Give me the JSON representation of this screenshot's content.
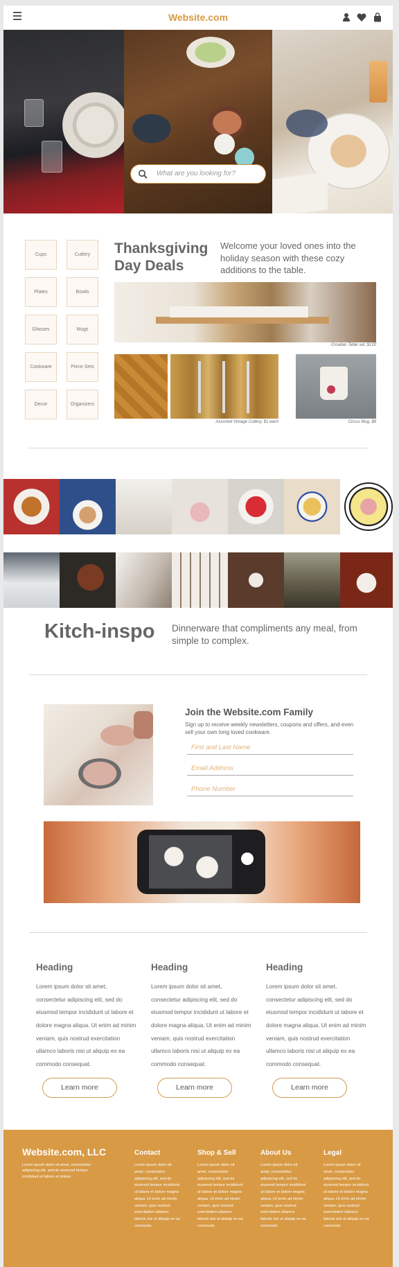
{
  "header": {
    "logo": "Website.com",
    "icons": [
      "menu-icon",
      "user-icon",
      "heart-icon",
      "shopping-bag-icon"
    ]
  },
  "search": {
    "placeholder": "What are you looking for?"
  },
  "categories": [
    "Cups",
    "Cutlery",
    "Plates",
    "Bowls",
    "Glasses",
    "Mugs",
    "Cookware",
    "Piece Sets",
    "Decor",
    "Organizers"
  ],
  "deals": {
    "title": "Thanksgiving Day Deals",
    "subtitle": "Welcome your loved ones into the holiday season with these cozy additions to the table.",
    "captions": {
      "table": "Croatian Table set, $120",
      "cutlery": "Assorted Vintage Cutlery, $1 each",
      "mug": "Circus Mug, $8"
    }
  },
  "inspo": {
    "title": "Kitch-inspo",
    "subtitle": "Dinnerware that compliments any meal, from simple to complex."
  },
  "join": {
    "title": "Join the Website.com Family",
    "description": "Sign up to receive weekly newsletters, coupons and offers, and even sell your own long loved cookware.",
    "fields": [
      "First and Last Name",
      "Email Address",
      "Phone Number"
    ]
  },
  "columns": [
    {
      "heading": "Heading",
      "body": "Lorem ipsum dolor sit amet, consectetur adipiscing elit, sed do eiusmod tempor incididunt ut labore et dolore magna aliqua. Ut enim ad minim veniam, quis nostrud exercitation ullamco laboris nisi ut aliquip ex ea commodo consequat.",
      "button": "Learn more"
    },
    {
      "heading": "Heading",
      "body": "Lorem ipsum dolor sit amet, consectetur adipiscing elit, sed do eiusmod tempor incididunt ut labore et dolore magna aliqua. Ut enim ad minim veniam, quis nostrud exercitation ullamco laboris nisi ut aliquip ex ea commodo consequat.",
      "button": "Learn more"
    },
    {
      "heading": "Heading",
      "body": "Lorem ipsum dolor sit amet, consectetur adipiscing elit, sed do eiusmod tempor incididunt ut labore et dolore magna aliqua. Ut enim ad minim veniam, quis nostrud exercitation ullamco laboris nisi ut aliquip ex ea commodo consequat.",
      "button": "Learn more"
    }
  ],
  "footer": {
    "brand": "Website.com, LLC",
    "description": "Lorem ipsum dolor sit amet, consectetur adipiscing elit, sed do eiusmod tempor incididunt ut labore et dolore.",
    "links": [
      {
        "heading": "Contact",
        "body": "Lorem ipsum dolor sit amet, consectetur adipiscing elit, sed do eiusmod tempor incididunt ut labore et dolore magna aliqua. Ut enim ad minim veniam, quis nostrud exercitation ullamco laboris nisi ut aliquip ex ea commodo"
      },
      {
        "heading": "Shop & Sell",
        "body": "Lorem ipsum dolor sit amet, consectetur adipiscing elit, sed do eiusmod tempor incididunt ut labore et dolore magna aliqua. Ut enim ad minim veniam, quis nostrud exercitation ullamco laboris nisi ut aliquip ex ea commodo"
      },
      {
        "heading": "About Us",
        "body": "Lorem ipsum dolor sit amet, consectetur adipiscing elit, sed do eiusmod tempor incididunt ut labore et dolore magna aliqua. Ut enim ad minim veniam, quis nostrud exercitation ullamco laboris nisi ut aliquip ex ea commodo"
      },
      {
        "heading": "Legal",
        "body": "Lorem ipsum dolor sit amet, consectetur adipiscing elit, sed do eiusmod tempor incididunt ut labore et dolore magna aliqua. Ut enim ad minim veniam, quis nostrud exercitation ullamco laboris nisi ut aliquip ex ea commodo"
      }
    ]
  },
  "colors": {
    "accent": "#d89a45",
    "text": "#666666",
    "category_bg": "#fdf8f3"
  }
}
